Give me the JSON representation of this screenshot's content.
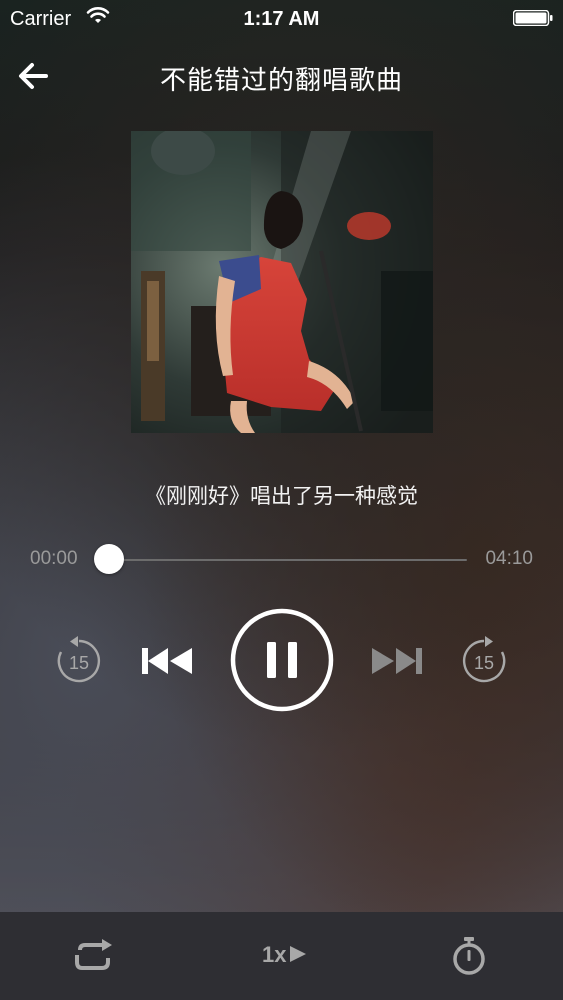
{
  "status_bar": {
    "carrier": "Carrier",
    "time": "1:17 AM"
  },
  "nav": {
    "title": "不能错过的翻唱歌曲",
    "back_icon": "arrow-left-icon"
  },
  "track": {
    "subtitle": "《刚刚好》唱出了另一种感觉",
    "elapsed": "00:00",
    "total": "04:10",
    "progress_fraction": 0.0
  },
  "controls": {
    "rewind_15_label": "15",
    "forward_15_label": "15",
    "state": "playing"
  },
  "bottom_bar": {
    "speed_label": "1x"
  },
  "colors": {
    "accent": "#ffffff",
    "muted": "#a8a8a8",
    "bottom_bar": "#2e2e33"
  }
}
